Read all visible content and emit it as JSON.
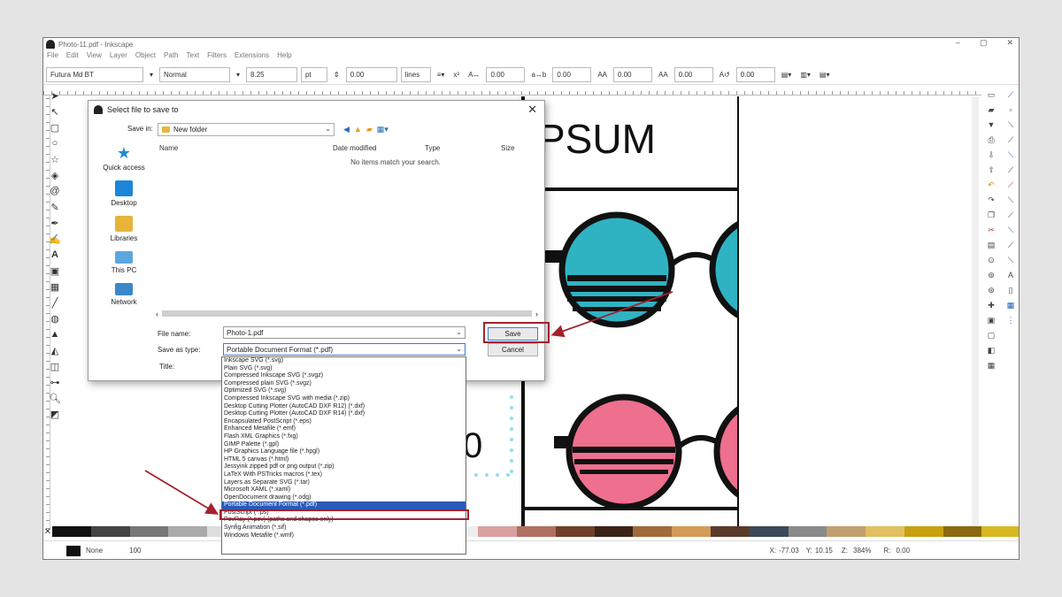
{
  "window": {
    "title": "Photo-11.pdf - Inkscape",
    "controls": [
      "–",
      "▢",
      "✕"
    ]
  },
  "menu": [
    "File",
    "Edit",
    "View",
    "Layer",
    "Object",
    "Path",
    "Text",
    "Filters",
    "Extensions",
    "Help"
  ],
  "toolbar": {
    "font_family": "Futura Md BT",
    "font_style": "Normal",
    "font_size": "8.25",
    "unit": "pt",
    "line_spacing": "0.00",
    "line_unit": "lines",
    "letter_spacing": "0.00",
    "word_spacing": "0.00",
    "kerning_h": "0.00",
    "kerning_v": "0.00",
    "rotation": "0.00"
  },
  "canvas": {
    "heading_text": "PSUM",
    "number_text": "0",
    "colors": {
      "teal": "#2fb3c3",
      "pink": "#ef6f8e"
    }
  },
  "dialog": {
    "title": "Select file to save to",
    "save_in_label": "Save in:",
    "folder": "New folder",
    "columns": {
      "name": "Name",
      "date": "Date modified",
      "type": "Type",
      "size": "Size"
    },
    "empty_message": "No items match your search.",
    "places": [
      {
        "label": "Quick access",
        "icon": "star-icon",
        "color": "#1f8ad6"
      },
      {
        "label": "Desktop",
        "icon": "desktop-icon",
        "color": "#1c86d8"
      },
      {
        "label": "Libraries",
        "icon": "library-icon",
        "color": "#e7b43a"
      },
      {
        "label": "This PC",
        "icon": "computer-icon",
        "color": "#5aa6dd"
      },
      {
        "label": "Network",
        "icon": "network-icon",
        "color": "#3a88c9"
      }
    ],
    "file_name_label": "File name:",
    "file_name_value": "Photo-1.pdf",
    "save_as_type_label": "Save as type:",
    "save_as_type_value": "Portable Document Format (*.pdf)",
    "title_label": "Title:",
    "save_button": "Save",
    "cancel_button": "Cancel"
  },
  "file_types": [
    "Inkscape SVG (*.svg)",
    "Plain SVG (*.svg)",
    "Compressed Inkscape SVG (*.svgz)",
    "Compressed plain SVG (*.svgz)",
    "Optimized SVG (*.svg)",
    "Compressed Inkscape SVG with media (*.zip)",
    "Desktop Cutting Plotter (AutoCAD DXF R12) (*.dxf)",
    "Desktop Cutting Plotter (AutoCAD DXF R14) (*.dxf)",
    "Encapsulated PostScript (*.eps)",
    "Enhanced Metafile (*.emf)",
    "Flash XML Graphics (*.fxg)",
    "GIMP Palette (*.gpl)",
    "HP Graphics Language file (*.hpgl)",
    "HTML 5 canvas (*.html)",
    "Jessyink zipped pdf or png output (*.zip)",
    "LaTeX With PSTricks macros (*.tex)",
    "Layers as Separate SVG (*.tar)",
    "Microsoft XAML (*.xaml)",
    "OpenDocument drawing (*.odg)",
    "Portable Document Format (*.pdf)",
    "PostScript (*.ps)",
    "PovRay (*.pov) (paths and shapes only)",
    "Synfig Animation (*.sif)",
    "Windows Metafile (*.wmf)"
  ],
  "selected_file_type_index": 19,
  "status": {
    "fill_label": "None",
    "opacity": "100",
    "x_label": "X:",
    "x_value": "-77.03",
    "y_label": "Y:",
    "y_value": "10.15",
    "z_label": "Z:",
    "zoom": "384%",
    "rotation_label": "R:",
    "rotation": "0.00"
  },
  "highlight_color": "#a3222c"
}
